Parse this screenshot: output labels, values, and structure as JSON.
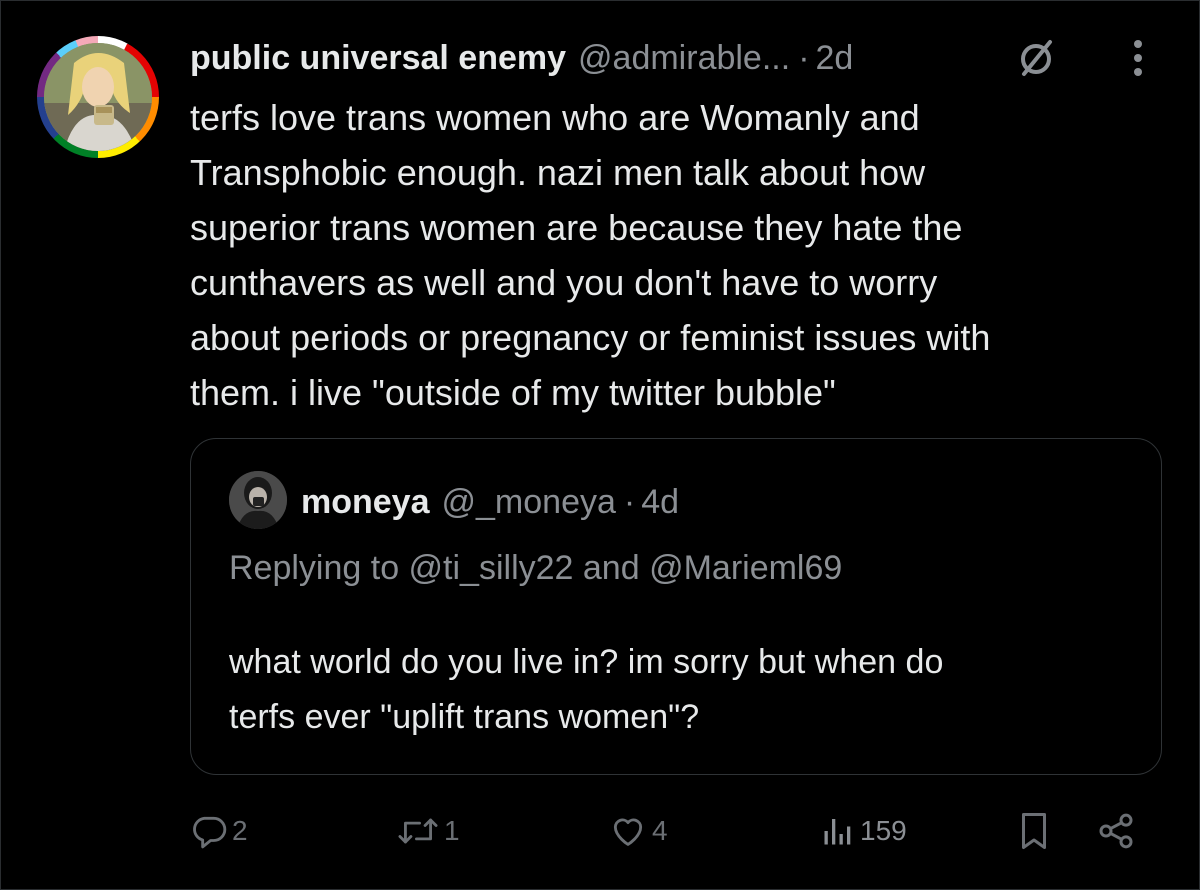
{
  "tweet": {
    "author_name": "public universal enemy",
    "author_handle": "@admirable...",
    "separator": "·",
    "time": "2d",
    "text": "terfs love trans women who are Womanly and\nTransphobic enough. nazi men talk about how\nsuperior trans women are because they hate the\ncunthavers as well and you don't have to worry\nabout periods or pregnancy or feminist issues with\nthem. i live \"outside of my twitter bubble\"",
    "icons": {
      "grok": "grok-slash-icon",
      "more": "more-vertical-icon",
      "avatar_ring": "rainbow-ring"
    }
  },
  "quote": {
    "author_name": "moneya",
    "author_handle": "@_moneya",
    "separator": "·",
    "time": "4d",
    "replying_to": "Replying to @ti_silly22 and @Marieml69",
    "text": "what world do you live in? im sorry but when do\nterfs ever \"uplift trans women\"?"
  },
  "actions": {
    "reply_count": "2",
    "retweet_count": "1",
    "like_count": "4",
    "views_count": "159",
    "icons": [
      "reply-icon",
      "retweet-icon",
      "like-icon",
      "views-icon",
      "bookmark-icon",
      "share-icon"
    ]
  },
  "colors": {
    "background": "#000000",
    "text_primary": "#e7e9ea",
    "text_secondary": "#8b8f94",
    "border": "#2f3336"
  }
}
